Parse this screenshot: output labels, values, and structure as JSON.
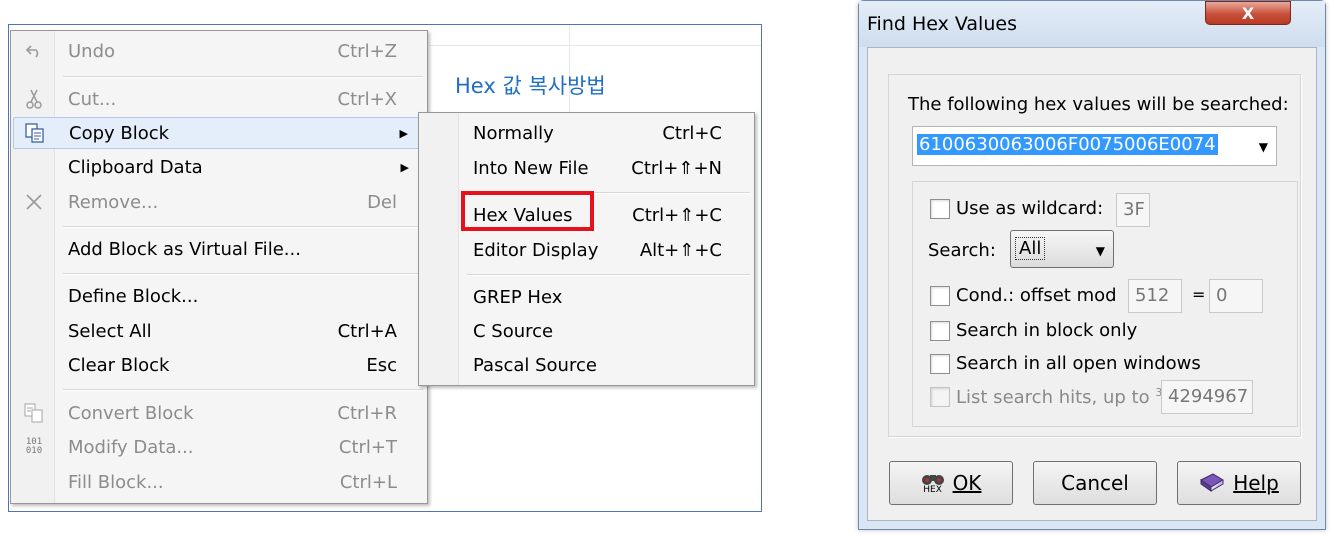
{
  "caption": "Hex 값 복사방법",
  "context_menu": {
    "items": [
      {
        "label": "Undo",
        "shortcut": "Ctrl+Z",
        "icon": "undo-icon",
        "disabled": true
      },
      {
        "label": "Cut...",
        "shortcut": "Ctrl+X",
        "icon": "scissors-icon",
        "disabled": true
      },
      {
        "label": "Copy Block",
        "shortcut": "",
        "icon": "copy-block-icon",
        "disabled": false,
        "submenu": true
      },
      {
        "label": "Clipboard Data",
        "shortcut": "",
        "icon": "",
        "disabled": false,
        "submenu": true
      },
      {
        "label": "Remove...",
        "shortcut": "Del",
        "icon": "remove-x-icon",
        "disabled": true
      },
      {
        "label": "Add Block as Virtual File...",
        "shortcut": "",
        "icon": "",
        "disabled": false
      },
      {
        "label": "Define Block...",
        "shortcut": "",
        "icon": "",
        "disabled": false
      },
      {
        "label": "Select All",
        "shortcut": "Ctrl+A",
        "icon": "",
        "disabled": false
      },
      {
        "label": "Clear Block",
        "shortcut": "Esc",
        "icon": "",
        "disabled": false
      },
      {
        "label": "Convert Block",
        "shortcut": "Ctrl+R",
        "icon": "convert-icon",
        "disabled": true
      },
      {
        "label": "Modify Data...",
        "shortcut": "Ctrl+T",
        "icon": "binary-modify-icon",
        "disabled": true
      },
      {
        "label": "Fill Block...",
        "shortcut": "Ctrl+L",
        "icon": "",
        "disabled": true
      }
    ],
    "binary_icon_text": "101\n010",
    "submenu_arrow": "▶"
  },
  "submenu": {
    "items": [
      {
        "label": "Normally",
        "shortcut": "Ctrl+C"
      },
      {
        "label": "Into New File",
        "shortcut": "Ctrl+⇑+N"
      },
      {
        "label": "Hex Values",
        "shortcut": "Ctrl+⇑+C"
      },
      {
        "label": "Editor Display",
        "shortcut": "Alt+⇑+C"
      },
      {
        "label": "GREP Hex",
        "shortcut": ""
      },
      {
        "label": "C Source",
        "shortcut": ""
      },
      {
        "label": "Pascal Source",
        "shortcut": ""
      }
    ]
  },
  "dialog": {
    "title": "Find Hex Values",
    "close_label": "X",
    "search_label": "The following hex values will be searched:",
    "hex_value": "6100630063006F0075006E0074",
    "use_wildcard_label": "Use as wildcard:",
    "wildcard_value": "3F",
    "search_label2": "Search:",
    "search_scope": "All",
    "cond_label": "Cond.: offset mod",
    "offset_mod": "512",
    "equals": "=",
    "offset_eq": "0",
    "block_only_label": "Search in block only",
    "all_windows_label": "Search in all open windows",
    "list_hits_label": "List search hits, up to",
    "list_hits_sup": "3",
    "list_hits_value": "4294967",
    "ok_label": "OK",
    "ok_icon_text": "HEX",
    "cancel_label": "Cancel",
    "help_label": "Help"
  }
}
